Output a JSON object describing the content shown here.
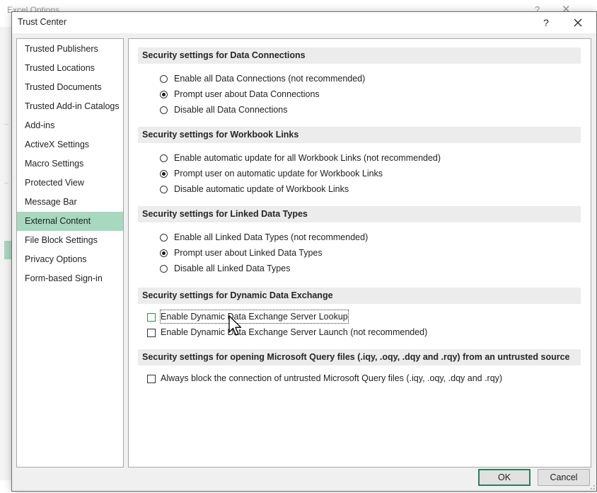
{
  "background_window": {
    "title": "Excel Options",
    "help": "?",
    "close": "✕"
  },
  "dialog": {
    "title": "Trust Center",
    "help_label": "?",
    "close_icon": "close-icon"
  },
  "sidebar": {
    "active_index": 9,
    "items": [
      {
        "label": "Trusted Publishers"
      },
      {
        "label": "Trusted Locations"
      },
      {
        "label": "Trusted Documents"
      },
      {
        "label": "Trusted Add-in Catalogs"
      },
      {
        "label": "Add-ins"
      },
      {
        "label": "ActiveX Settings"
      },
      {
        "label": "Macro Settings"
      },
      {
        "label": "Protected View"
      },
      {
        "label": "Message Bar"
      },
      {
        "label": "External Content"
      },
      {
        "label": "File Block Settings"
      },
      {
        "label": "Privacy Options"
      },
      {
        "label": "Form-based Sign-in"
      }
    ]
  },
  "sections": {
    "data_connections": {
      "header": "Security settings for Data Connections",
      "options": [
        {
          "label": "Enable all Data Connections (not recommended)",
          "selected": false
        },
        {
          "label": "Prompt user about Data Connections",
          "selected": true
        },
        {
          "label": "Disable all Data Connections",
          "selected": false
        }
      ]
    },
    "workbook_links": {
      "header": "Security settings for Workbook Links",
      "options": [
        {
          "label": "Enable automatic update for all Workbook Links (not recommended)",
          "selected": false
        },
        {
          "label": "Prompt user on automatic update for Workbook Links",
          "selected": true
        },
        {
          "label": "Disable automatic update of Workbook Links",
          "selected": false
        }
      ]
    },
    "linked_data_types": {
      "header": "Security settings for Linked Data Types",
      "options": [
        {
          "label": "Enable all Linked Data Types (not recommended)",
          "selected": false
        },
        {
          "label": "Prompt user about Linked Data Types",
          "selected": true
        },
        {
          "label": "Disable all Linked Data Types",
          "selected": false
        }
      ]
    },
    "dde": {
      "header": "Security settings for Dynamic Data Exchange",
      "options": [
        {
          "label": "Enable Dynamic Data Exchange Server Lookup",
          "checked": false
        },
        {
          "label": "Enable Dynamic Data Exchange Server Launch (not recommended)",
          "checked": false
        }
      ]
    },
    "query_files": {
      "header": "Security settings for opening  Microsoft Query files (.iqy, .oqy, .dqy and .rqy) from an untrusted source",
      "options": [
        {
          "label": "Always block the connection of untrusted Microsoft Query files (.iqy, .oqy, .dqy and .rqy)",
          "checked": false
        }
      ]
    }
  },
  "buttons": {
    "ok": "OK",
    "cancel": "Cancel"
  },
  "colors": {
    "active_nav": "#a7d9bf",
    "default_button_border": "#2f7d5a"
  }
}
